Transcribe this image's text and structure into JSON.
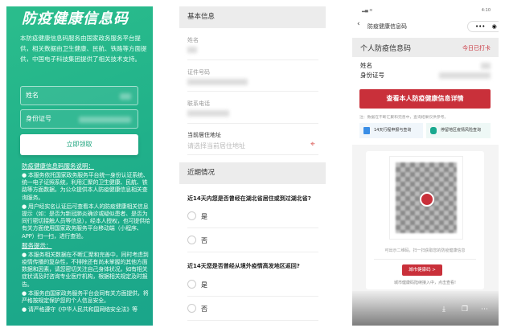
{
  "panel1": {
    "title": "防疫健康信息码",
    "intro": "本防疫健康信息码服务由国家政务服务平台提供，相关数据由卫生健康、民航、铁路等方面提供，中国电子科技集团提供了相关技术支持。",
    "name_label": "姓名",
    "id_label": "身份证号",
    "submit": "立即领取",
    "section1": "防疫健康信息码服务说明：",
    "bullets1": [
      "● 本服务依托国家政务服务平台统一身份认证系统、统一电子证照系统，利用汇聚的卫生健康、民航、铁路等方面数据，为公众提供本人防疫健康信息相关查询服务。",
      "● 用户经实名认证后可查看本人的防疫健康相关信息提示（如：是否为新冠肺炎确诊或疑似患者、是否为同行密切接触人员等信息），经本人授权，也可提供给有关方面使用国家政务服务平台移动端（小程序、APP）扫一扫，进行查验。"
    ],
    "section2": "服务提示：",
    "bullets2": [
      "● 本服务相关数据在不断汇聚和完善中，同时考虑到疫情传播的复杂性，不排除还有尚未掌握的其他方面数据和因素，请您密切关注自己身体状况，如有相关症状请及时咨询专业医疗机构，根据相关规定及时报告。",
      "● 本服务由国家政务服务平台会同有关方面提供，将严格按规定保护您的个人信息安全。",
      "● 请严格遵守《中华人民共和国网络安全法》等"
    ]
  },
  "panel2": {
    "basic_header": "基本信息",
    "name_label": "姓名",
    "id_label": "证件号码",
    "phone_label": "联系电话",
    "address_label": "当前居住地址",
    "address_placeholder": "请选择当前居住地址",
    "recent_header": "近期情况",
    "questions": [
      {
        "text": "近14天内您是否曾经在湖北省居住或到过湖北省?",
        "options": [
          "是",
          "否"
        ]
      },
      {
        "text": "近14天您是否曾经从境外疫情高发地区返回?",
        "options": [
          "是",
          "否"
        ]
      }
    ]
  },
  "panel3": {
    "status_time": "4:10",
    "nav_title": "防疫健康信息码",
    "card_title": "个人防疫信息码",
    "checkin": "今日已打卡",
    "name_label": "姓名",
    "id_label": "身份证号",
    "detail_button": "查看本人防疫健康信息详情",
    "note": "注：数据在不断汇聚和完善中，查询结果仅供参考。",
    "chip1": "14天行程申报与查询",
    "chip2": "停留地区疫情风险查询",
    "qr_caption": "可出示二维码，扫一扫获取您的防疫健康信息",
    "city_button": "城市健康码 >",
    "city_note": "城市健康码陆续接入中，点击查看!"
  },
  "colors": {
    "green": "#22b08a",
    "red": "#c9303a"
  }
}
